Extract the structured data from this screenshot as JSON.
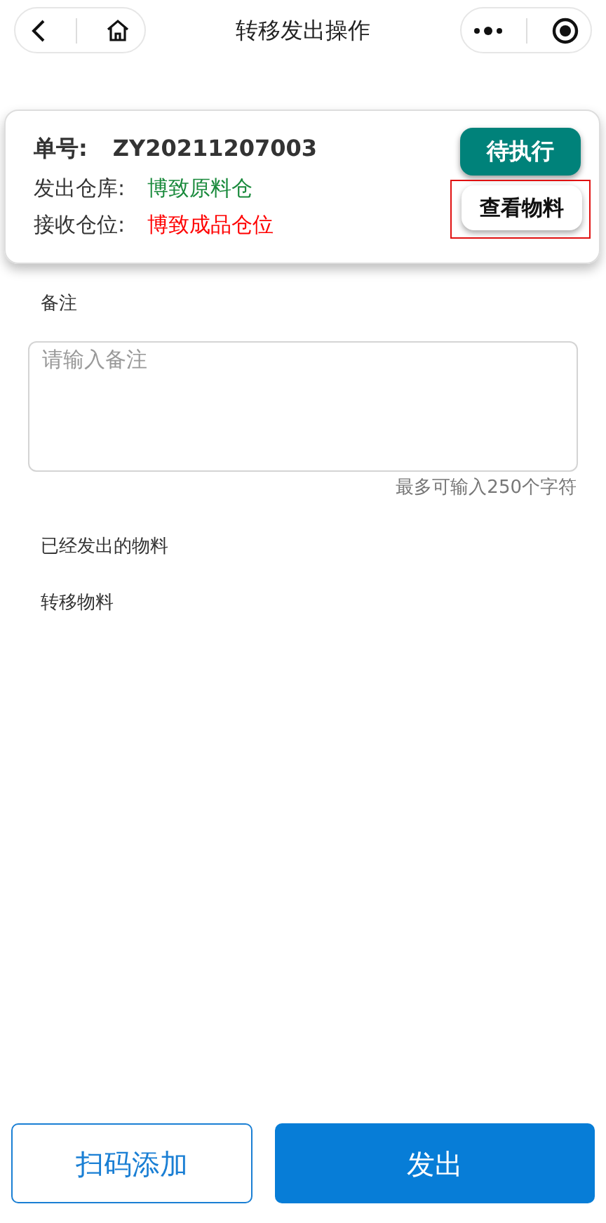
{
  "nav_bar": {
    "title": "转移发出操作"
  },
  "order_card": {
    "fields": [
      {
        "label": "单号:",
        "value": "ZY20211207003",
        "kind": "code"
      },
      {
        "label": "发出仓库:",
        "value": "博致原料仓",
        "color": "#1a8a3c"
      },
      {
        "label": "接收仓位:",
        "value": "博致成品仓位",
        "color": "#ff0000"
      }
    ],
    "status_button": "待执行",
    "materials_button": {
      "label": "查看物料",
      "highlighted": true
    }
  },
  "remark": {
    "label": "备注",
    "placeholder": "请输入备注",
    "hint": "最多可输入250个字符"
  },
  "sections": [
    "已经发出的物料",
    "转移物料"
  ],
  "footer_buttons": [
    {
      "label": "扫码添加",
      "kind": "outline"
    },
    {
      "label": "发出",
      "kind": "primary"
    }
  ]
}
